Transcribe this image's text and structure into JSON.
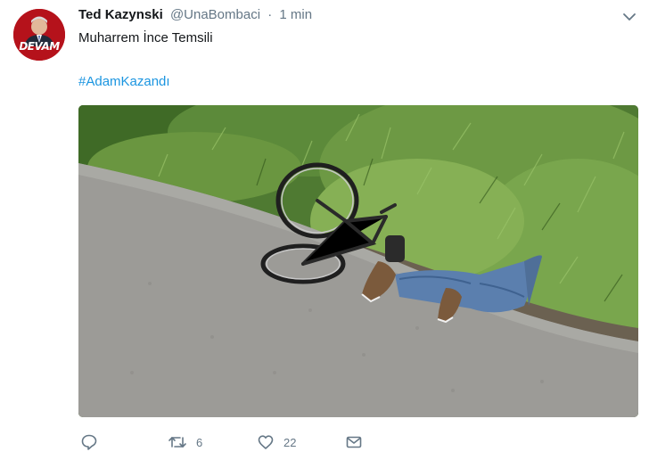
{
  "tweet": {
    "author": {
      "display_name": "Ted Kazynski",
      "handle": "@UnaBombaci",
      "avatar_text": "DEVAM"
    },
    "separator": "·",
    "time": "1 min",
    "text_line1": "Muharrem İnce Temsili",
    "hashtag": "#AdamKazandı",
    "media": {
      "icon": "photo-cyclist-on-path"
    },
    "actions": {
      "reply": {
        "icon": "reply-icon"
      },
      "retweet": {
        "icon": "retweet-icon",
        "count": "6"
      },
      "like": {
        "icon": "heart-icon",
        "count": "22"
      },
      "dm": {
        "icon": "envelope-icon"
      }
    },
    "menu": {
      "icon": "chevron-down-icon"
    }
  },
  "colors": {
    "link": "#1b95e0",
    "muted": "#657786",
    "text": "#14171a",
    "avatar_bg": "#b5121b"
  }
}
